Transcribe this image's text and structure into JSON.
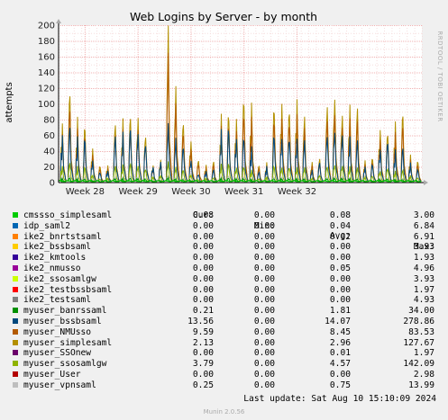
{
  "chart_data": {
    "type": "line",
    "title": "Web Logins by Server - by month",
    "ylabel": "attempts",
    "side_text": "RRDTOOL / TOBI OETIKER",
    "ylim": [
      0,
      200
    ],
    "yticks": [
      "0",
      "20",
      "40",
      "60",
      "80",
      "100",
      "120",
      "140",
      "160",
      "180",
      "200"
    ],
    "xticks": [
      "Week 28",
      "Week 29",
      "Week 30",
      "Week 31",
      "Week 32"
    ],
    "grid": true,
    "legend_headers": {
      "cur": "Cur:",
      "min": "Min:",
      "avg": "Avg:",
      "max": "Max:"
    },
    "series": [
      {
        "name": "cmssso_simplesaml",
        "color": "#00cc00",
        "cur": "0.08",
        "min": "0.00",
        "avg": "0.08",
        "max": "3.00"
      },
      {
        "name": "idp_saml2",
        "color": "#0066b3",
        "cur": "0.00",
        "min": "0.00",
        "avg": "0.04",
        "max": "6.84"
      },
      {
        "name": "ike2_bnrtstsaml",
        "color": "#ff8000",
        "cur": "0.00",
        "min": "0.00",
        "avg": "0.02",
        "max": "6.91"
      },
      {
        "name": "ike2_bssbsaml",
        "color": "#ffcc00",
        "cur": "0.00",
        "min": "0.00",
        "avg": "0.00",
        "max": "3.93"
      },
      {
        "name": "ike2_kmtools",
        "color": "#330099",
        "cur": "0.00",
        "min": "0.00",
        "avg": "0.00",
        "max": "1.93"
      },
      {
        "name": "ike2_nmusso",
        "color": "#990099",
        "cur": "0.00",
        "min": "0.00",
        "avg": "0.05",
        "max": "4.96"
      },
      {
        "name": "ike2_ssosamlgw",
        "color": "#ccff00",
        "cur": "0.00",
        "min": "0.00",
        "avg": "0.00",
        "max": "3.93"
      },
      {
        "name": "ike2_testbssbsaml",
        "color": "#ff0000",
        "cur": "0.00",
        "min": "0.00",
        "avg": "0.00",
        "max": "1.97"
      },
      {
        "name": "ike2_testsaml",
        "color": "#808080",
        "cur": "0.00",
        "min": "0.00",
        "avg": "0.00",
        "max": "4.93"
      },
      {
        "name": "myuser_banrssaml",
        "color": "#008f00",
        "cur": "0.21",
        "min": "0.00",
        "avg": "1.81",
        "max": "34.00"
      },
      {
        "name": "myuser_bssbsaml",
        "color": "#00487d",
        "cur": "13.56",
        "min": "0.00",
        "avg": "14.07",
        "max": "278.86"
      },
      {
        "name": "myuser_NMUsso",
        "color": "#b35a00",
        "cur": "9.59",
        "min": "0.00",
        "avg": "8.45",
        "max": "83.53"
      },
      {
        "name": "myuser_simplesaml",
        "color": "#b38f00",
        "cur": "2.13",
        "min": "0.00",
        "avg": "2.96",
        "max": "127.67"
      },
      {
        "name": "myuser_SSOnew",
        "color": "#6b006b",
        "cur": "0.00",
        "min": "0.00",
        "avg": "0.01",
        "max": "1.97"
      },
      {
        "name": "myuser_ssosamlgw",
        "color": "#8fb300",
        "cur": "3.79",
        "min": "0.00",
        "avg": "4.57",
        "max": "142.09"
      },
      {
        "name": "myuser_User",
        "color": "#b30000",
        "cur": "0.00",
        "min": "0.00",
        "avg": "0.00",
        "max": "2.98"
      },
      {
        "name": "myuser_vpnsaml",
        "color": "#bebebe",
        "cur": "0.25",
        "min": "0.00",
        "avg": "0.75",
        "max": "13.99"
      }
    ],
    "envelope": {
      "note_series": [
        "myuser_bssbsaml",
        "myuser_NMUsso",
        "myuser_simplesaml"
      ],
      "daily_peaks_bssbsaml": [
        60,
        65,
        55,
        50,
        30,
        12,
        15,
        55,
        60,
        65,
        65,
        50,
        20,
        25,
        70,
        55,
        45,
        30,
        10,
        14,
        15,
        65,
        62,
        60,
        55,
        45,
        12,
        20,
        55,
        60,
        55,
        55,
        50,
        15,
        25,
        62,
        68,
        60,
        55,
        50,
        20,
        22,
        45,
        50,
        40,
        40,
        25,
        15
      ],
      "daily_peaks_total": [
        75,
        105,
        80,
        65,
        45,
        20,
        22,
        70,
        78,
        80,
        85,
        60,
        22,
        28,
        190,
        120,
        75,
        55,
        28,
        22,
        25,
        85,
        80,
        85,
        100,
        100,
        20,
        25,
        88,
        105,
        90,
        105,
        80,
        25,
        30,
        100,
        110,
        85,
        95,
        90,
        28,
        30,
        70,
        60,
        75,
        80,
        35,
        25
      ]
    }
  },
  "footer": {
    "last_update": "Last update: Sat Aug 10 15:10:09 2024",
    "munin": "Munin 2.0.56"
  }
}
